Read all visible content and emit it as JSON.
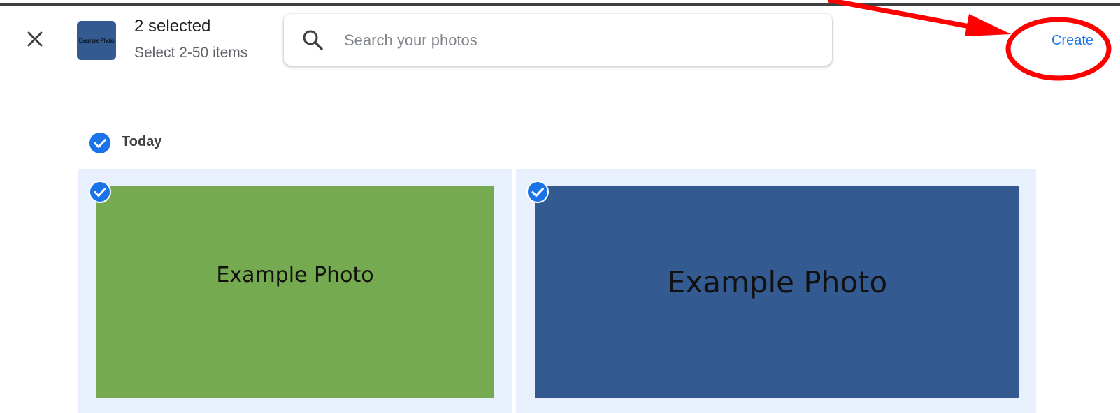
{
  "header": {
    "selected_count": "2 selected",
    "selection_hint": "Select 2-50 items",
    "thumbnail_text": "Example Photo",
    "create_label": "Create"
  },
  "search": {
    "placeholder": "Search your photos",
    "value": ""
  },
  "section": {
    "label": "Today"
  },
  "photos": [
    {
      "text": "Example Photo",
      "color": "#76aa51",
      "selected": true
    },
    {
      "text": "Example Photo",
      "color": "#335a91",
      "selected": true
    }
  ],
  "colors": {
    "accent": "#1a73e8",
    "annotation": "#ff0000",
    "selected_bg": "#e8f0fe"
  },
  "icons": {
    "close": "close-icon",
    "search": "search-icon",
    "check": "check-circle-icon"
  }
}
